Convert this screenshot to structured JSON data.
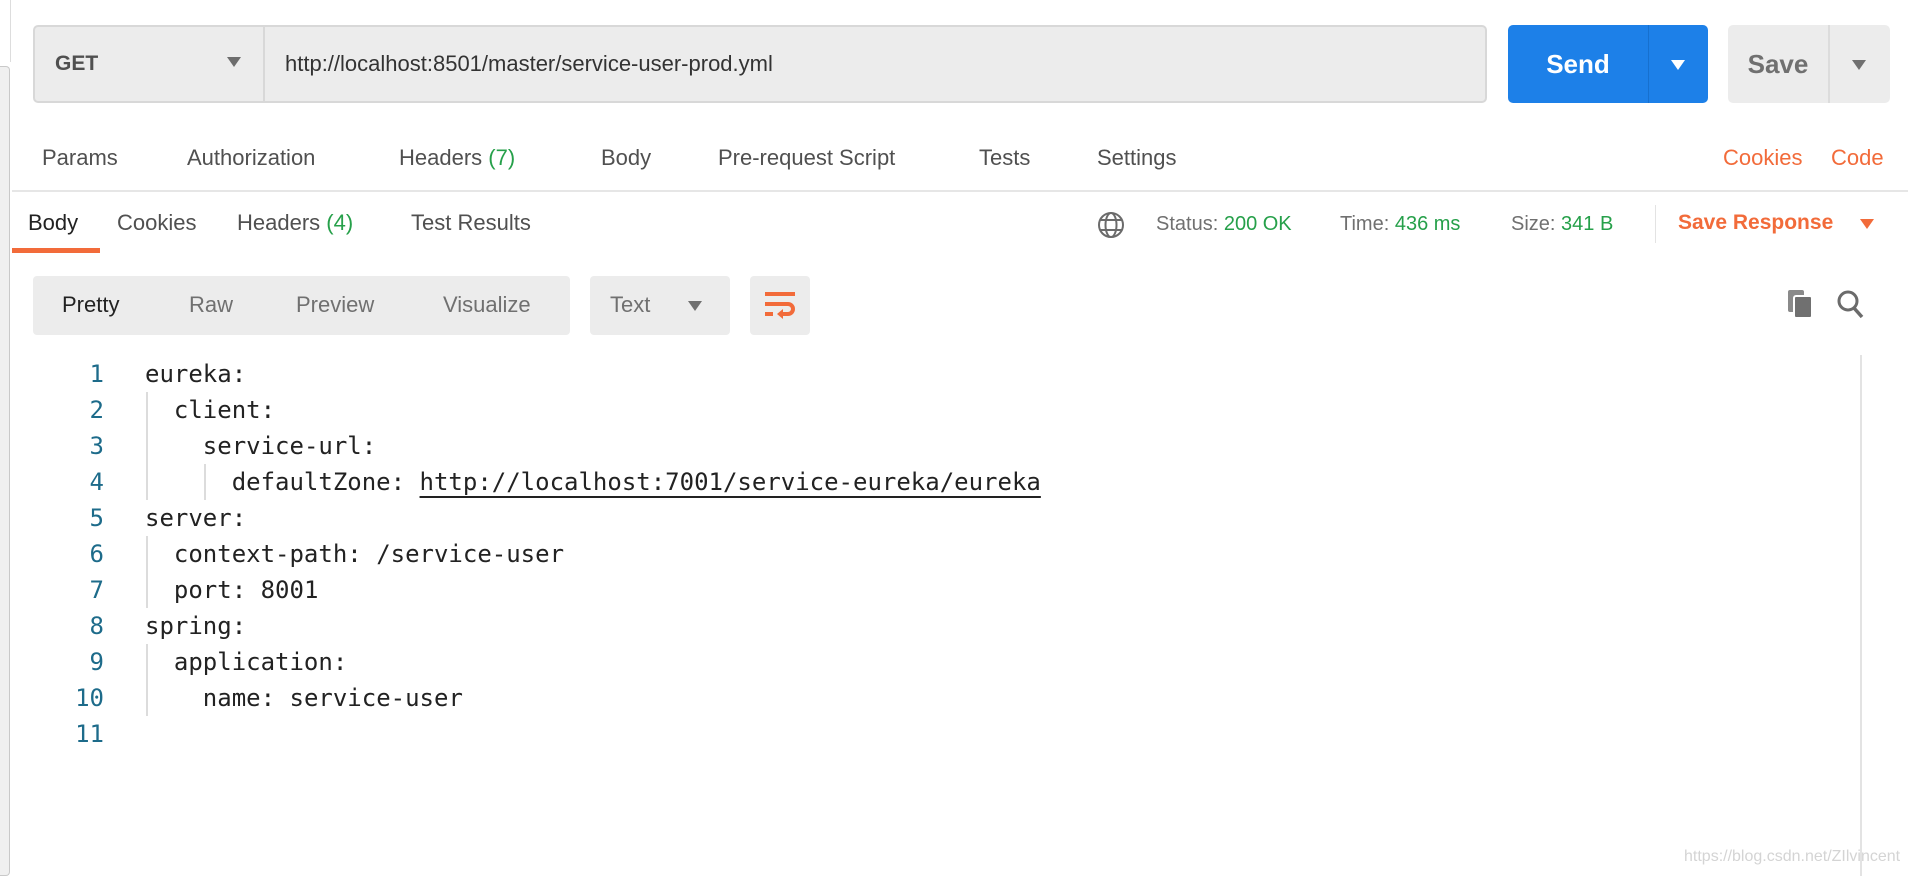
{
  "request": {
    "method": "GET",
    "url": "http://localhost:8501/master/service-user-prod.yml",
    "send_label": "Send",
    "save_label": "Save"
  },
  "request_tabs": [
    {
      "label": "Params"
    },
    {
      "label": "Authorization"
    },
    {
      "label": "Headers",
      "count": "(7)"
    },
    {
      "label": "Body"
    },
    {
      "label": "Pre-request Script"
    },
    {
      "label": "Tests"
    },
    {
      "label": "Settings"
    }
  ],
  "request_links": {
    "cookies": "Cookies",
    "code": "Code"
  },
  "response_tabs": [
    {
      "label": "Body",
      "active": true
    },
    {
      "label": "Cookies"
    },
    {
      "label": "Headers",
      "count": "(4)"
    },
    {
      "label": "Test Results"
    }
  ],
  "status": {
    "status_label": "Status:",
    "status_value": "200 OK",
    "time_label": "Time:",
    "time_value": "436 ms",
    "size_label": "Size:",
    "size_value": "341 B",
    "save_response": "Save Response"
  },
  "view_toolbar": {
    "modes": [
      "Pretty",
      "Raw",
      "Preview",
      "Visualize"
    ],
    "active_mode": "Pretty",
    "format": "Text"
  },
  "icons": {
    "network": "globe-icon",
    "wrap": "wrap-lines-icon",
    "copy": "copy-icon",
    "search": "search-icon"
  },
  "colors": {
    "accent": "#f26b3a",
    "send": "#1d80e8",
    "success": "#26a04a",
    "line_number": "#1d6b8a"
  },
  "code_lines": [
    {
      "n": "1",
      "indent": "",
      "key": "eureka:",
      "value": ""
    },
    {
      "n": "2",
      "indent": "  ",
      "key": "client:",
      "value": ""
    },
    {
      "n": "3",
      "indent": "    ",
      "key": "service-url:",
      "value": ""
    },
    {
      "n": "4",
      "indent": "      ",
      "key": "defaultZone: ",
      "value": "http://localhost:7001/service-eureka/eureka",
      "link": true
    },
    {
      "n": "5",
      "indent": "",
      "key": "server:",
      "value": ""
    },
    {
      "n": "6",
      "indent": "  ",
      "key": "context-path: ",
      "value": "/service-user"
    },
    {
      "n": "7",
      "indent": "  ",
      "key": "port: ",
      "value": "8001"
    },
    {
      "n": "8",
      "indent": "",
      "key": "spring:",
      "value": ""
    },
    {
      "n": "9",
      "indent": "  ",
      "key": "application:",
      "value": ""
    },
    {
      "n": "10",
      "indent": "    ",
      "key": "name: ",
      "value": "service-user"
    },
    {
      "n": "11",
      "indent": "",
      "key": "",
      "value": ""
    }
  ],
  "watermark": "https://blog.csdn.net/ZIlvincent"
}
